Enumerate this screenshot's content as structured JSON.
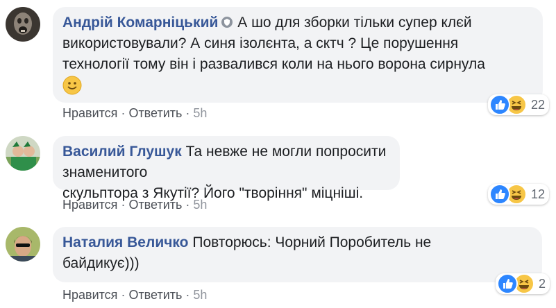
{
  "comments": [
    {
      "author": "Андрій Комарніцький",
      "text_lines": [
        "А шо для зборки тільки супер клєй",
        "використовували? А синя ізолєнта, а сктч ? Це порушення",
        "технології тому він і развалився коли на нього ворона сирнула"
      ],
      "emoji": "smiley-emoji",
      "like_label": "Нравится",
      "reply_label": "Ответить",
      "time": "5h",
      "reaction_count": "22",
      "verified_icon": "shield-badge-icon"
    },
    {
      "author": "Василий Глушук",
      "text_lines": [
        "Та невже не могли попросити знаменитого",
        "скульптора з Якутії? Його \"творіння\" міцніші."
      ],
      "like_label": "Нравится",
      "reply_label": "Ответить",
      "time": "5h",
      "reaction_count": "12"
    },
    {
      "author": "Наталия Величко",
      "text_lines": [
        "Повторюсь: Чорний Поробитель не",
        "байдикує)))"
      ],
      "like_label": "Нравится",
      "reply_label": "Ответить",
      "time": "5h",
      "reaction_count": "2"
    }
  ],
  "colors": {
    "author": "#385898",
    "bubble": "#f2f3f5",
    "like_reaction": "#2d86ff",
    "haha_reaction": "#f7c646"
  }
}
